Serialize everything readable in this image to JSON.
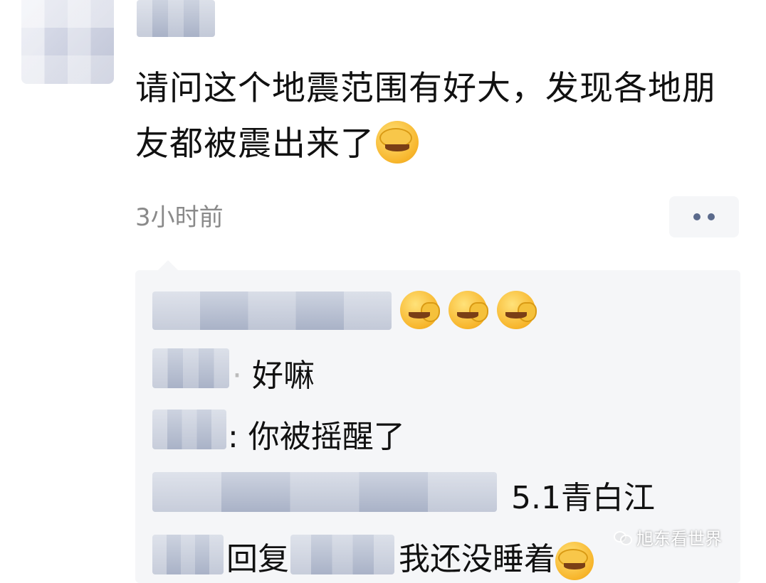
{
  "post": {
    "text": "请问这个地震范围有好大，发现各地朋友都被震出来了",
    "emoji": "facepalm-crying-emoji",
    "timestamp": "3小时前",
    "more_icon": "more-dots-icon"
  },
  "comments": [
    {
      "text": "",
      "emojis": [
        "hand-over-mouth-emoji",
        "hand-over-mouth-emoji",
        "hand-over-mouth-emoji"
      ]
    },
    {
      "text": "好嘛"
    },
    {
      "text": ": 你被摇醒了"
    },
    {
      "text": "5.1青白江"
    },
    {
      "reply_label": "回复",
      "text": "我还没睡着",
      "emoji": "facepalm-crying-emoji"
    }
  ],
  "watermark": {
    "text": "旭东看世界"
  },
  "colors": {
    "timestamp": "#8a8a8a",
    "panel_bg": "#f5f6f8",
    "dots": "#5b6a8c"
  }
}
